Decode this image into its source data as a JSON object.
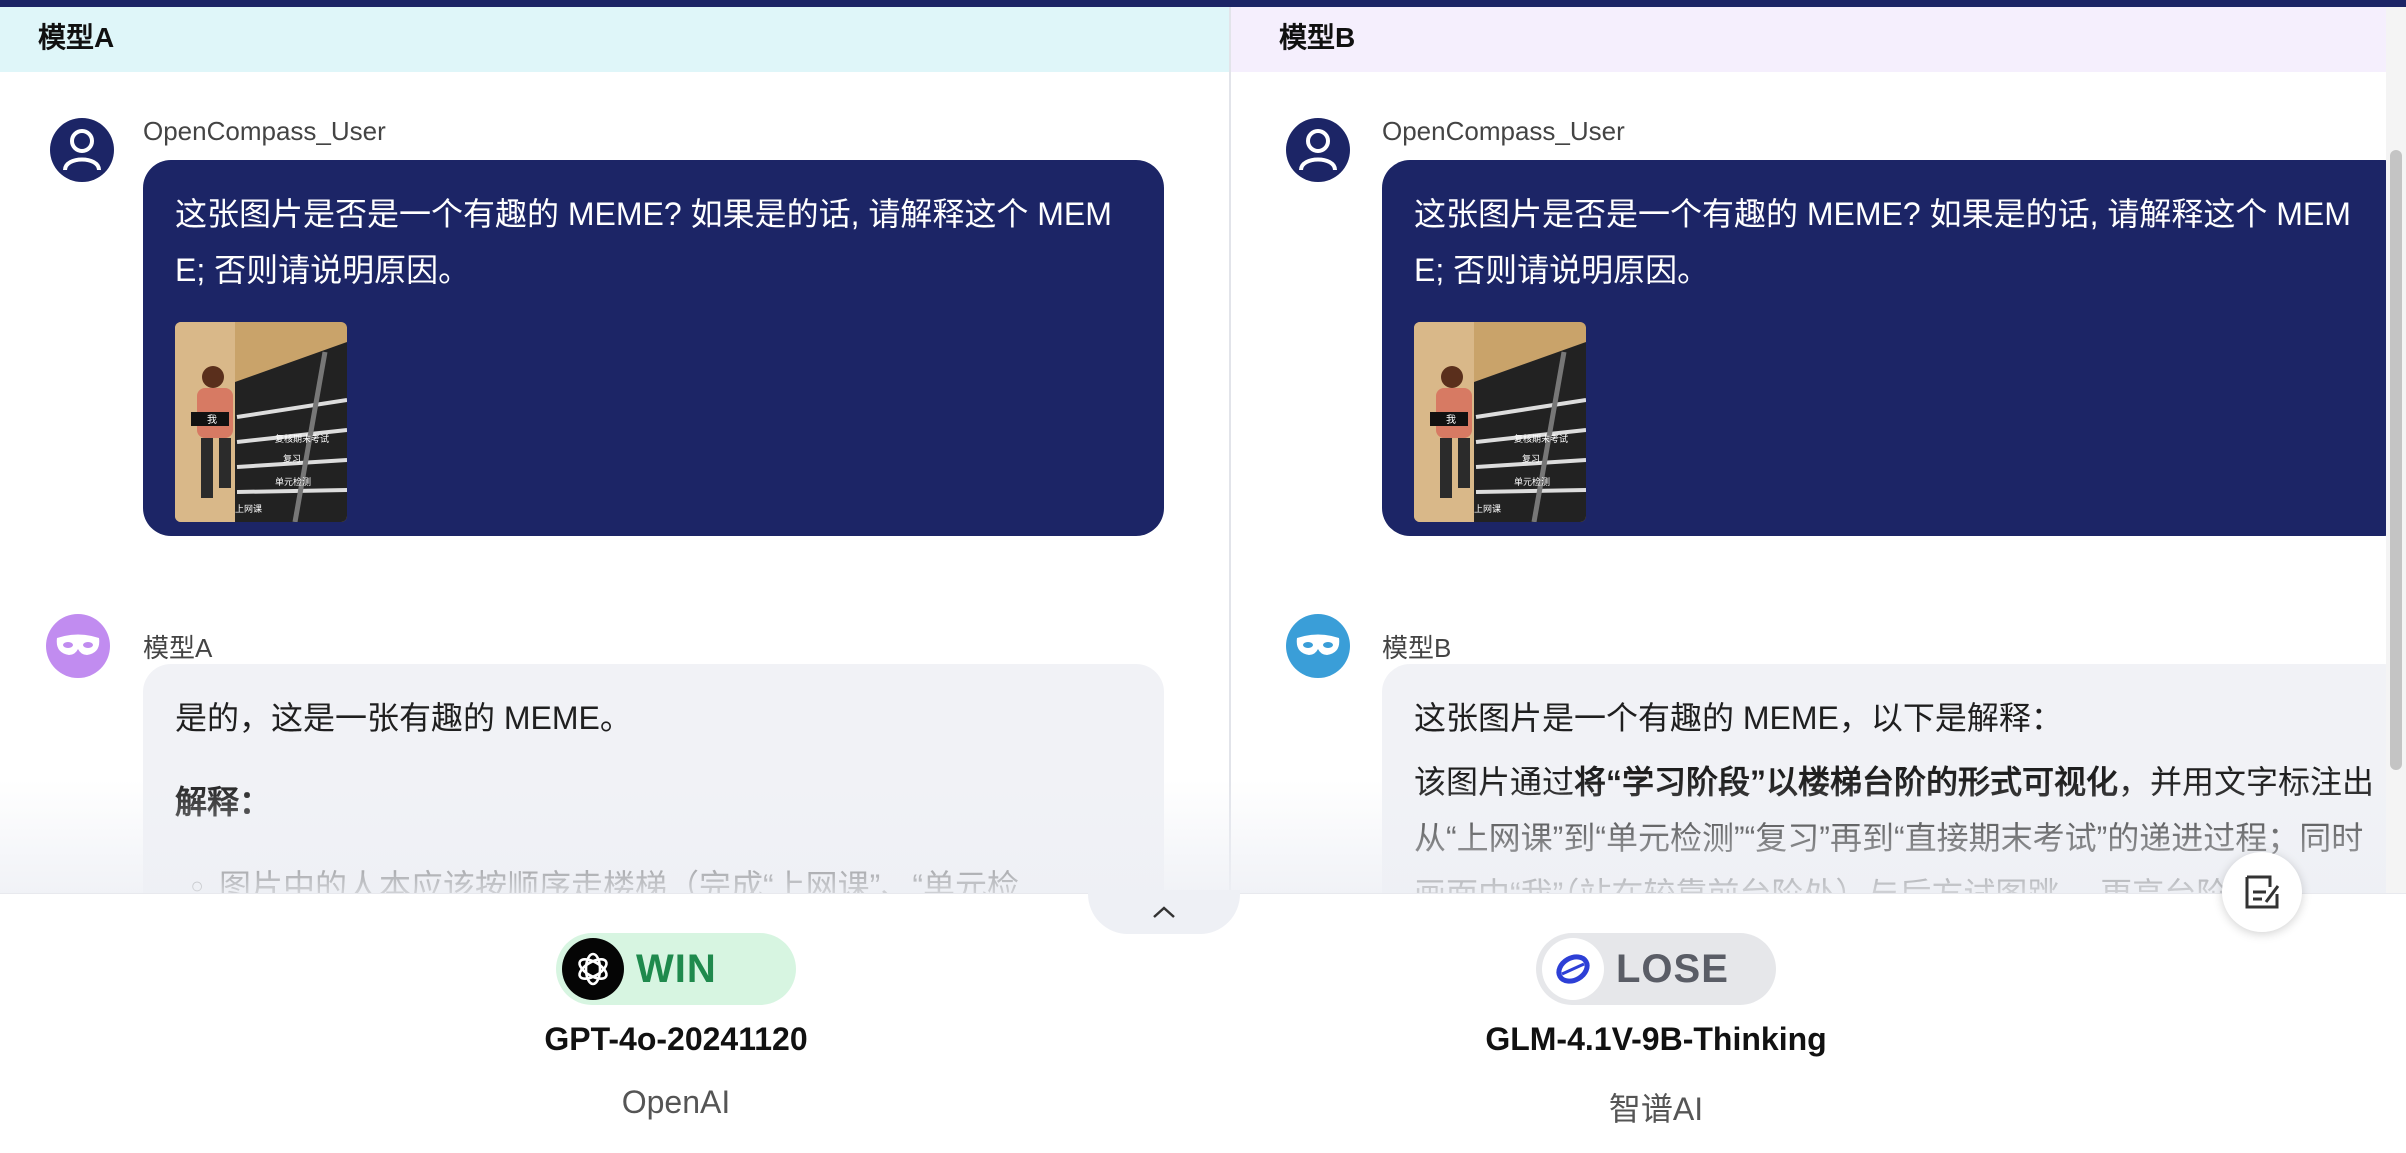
{
  "panels": {
    "a": {
      "header": "模型A",
      "user_name": "OpenCompass_User",
      "user_message": "这张图片是否是一个有趣的 MEME? 如果是的话, 请解释这个 MEME; 否则请说明原因。",
      "image_labels": [
        "我",
        "复核期末考试",
        "复习",
        "单元检测",
        "上网课"
      ],
      "bot_name": "模型A",
      "bot_lines": {
        "intro": "是的，这是一张有趣的 MEME。",
        "heading": "解释：",
        "bullet": "图片中的人本应该按顺序走楼梯（完成“上网课”、“单元检"
      }
    },
    "b": {
      "header": "模型B",
      "user_name": "OpenCompass_User",
      "user_message": "这张图片是否是一个有趣的 MEME? 如果是的话, 请解释这个 MEME; 否则请说明原因。",
      "image_labels": [
        "我",
        "复核期末考试",
        "复习",
        "单元检测",
        "上网课"
      ],
      "bot_name": "模型B",
      "bot_lines": {
        "intro": "这张图片是一个有趣的 MEME，以下是解释：",
        "para_pre": "该图片通过",
        "para_bold": "将“学习阶段”以楼梯台阶的形式可视化",
        "para_post": "，并用文字标注出从“上网课”到“单元检测”“复习”再到“直接期末考试”的递进过程；同时画面中“我”（站在较靠前台阶处）与后方试图跳… 更高台阶时的"
      }
    }
  },
  "results": {
    "a": {
      "badge": "WIN",
      "model": "GPT-4o-20241120",
      "vendor": "OpenAI"
    },
    "b": {
      "badge": "LOSE",
      "model": "GLM-4.1V-9B-Thinking",
      "vendor": "智谱AI"
    }
  },
  "icons": {
    "user_avatar": "user-icon",
    "bot_avatar": "mask-icon",
    "collapse": "chevron-up-icon",
    "float": "edit-note-icon"
  },
  "colors": {
    "accent_navy": "#1c2566",
    "win_green": "#1f8a4d",
    "panel_a_header": "#dff6f9",
    "panel_b_header": "#f5effd"
  }
}
